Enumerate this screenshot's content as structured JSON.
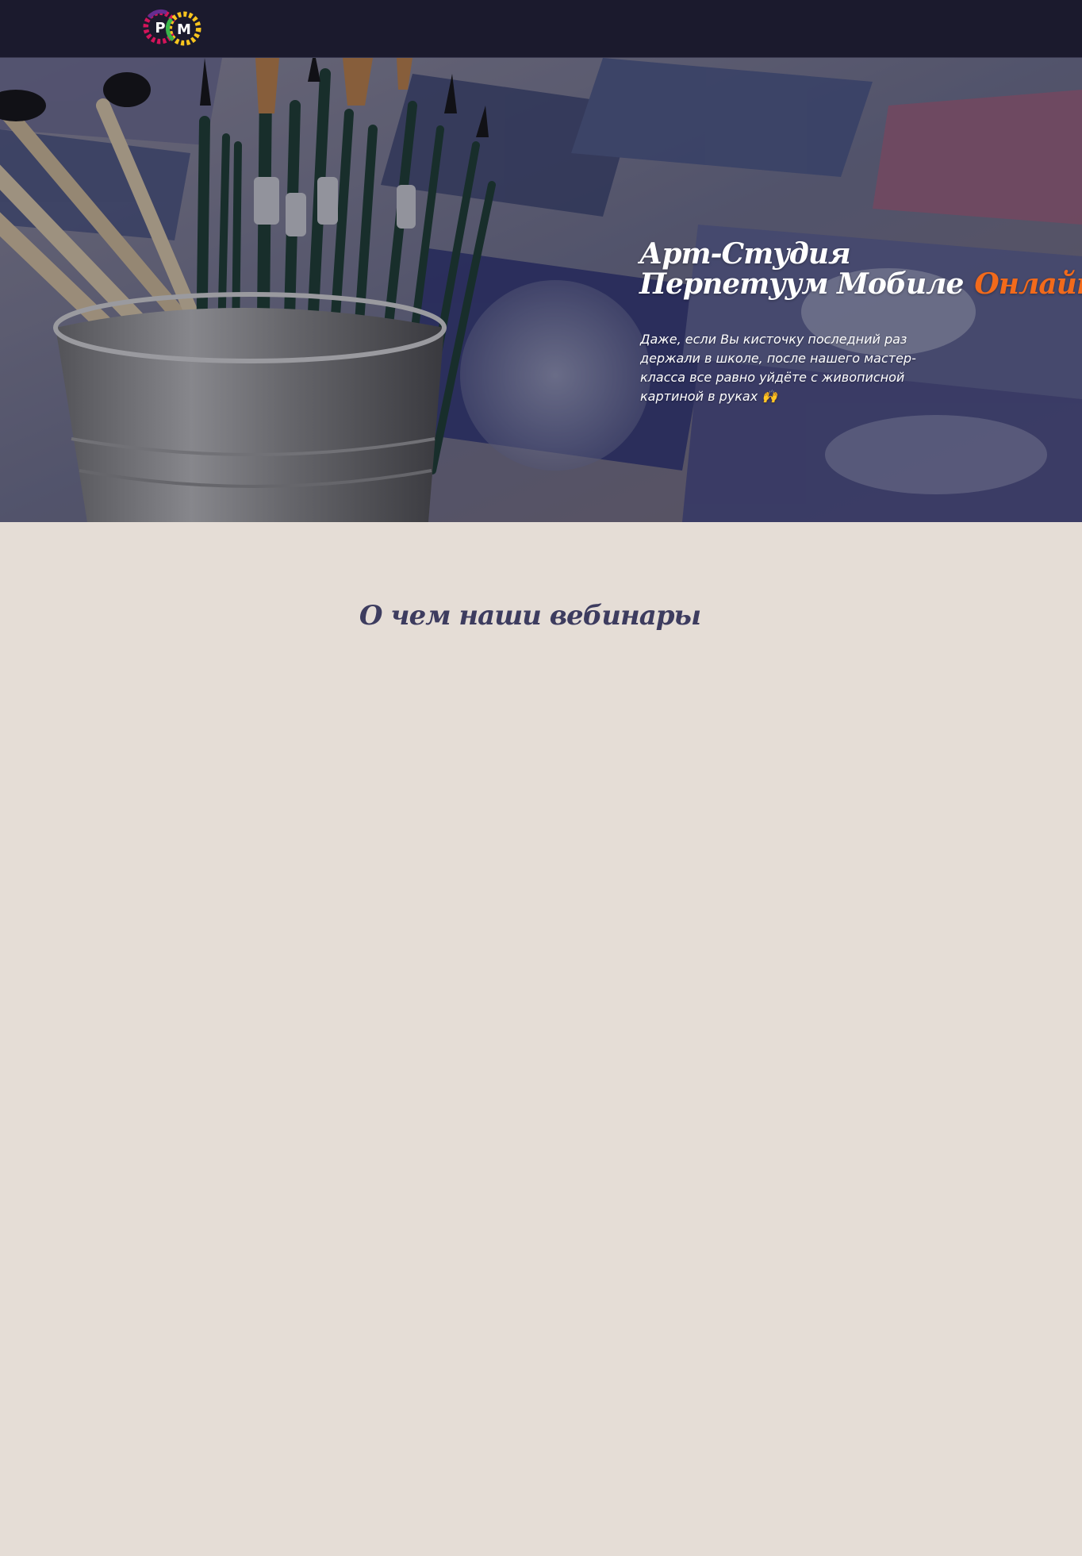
{
  "header": {
    "logo_letters": [
      "P",
      "M"
    ],
    "logo_colors": [
      "#d4145a",
      "#f7931e"
    ]
  },
  "hero": {
    "title_line1": "Арт-Студия",
    "title_line2": "Перпетуум Мобиле",
    "title_accent": "Онлайн",
    "accent_color": "#f26a1b",
    "text": "Даже, если Вы кисточку последний раз держали в школе, после нашего мастер-класса все равно уйдёте с живописной картиной в руках 🙌",
    "image": "paint-brushes-in-metal-cup-photo"
  },
  "webinars": {
    "title": "О чем наши вебинары"
  },
  "colors": {
    "header_bg": "#1b1a2d",
    "page_bg": "#e5ddd6",
    "section_title": "#3d3c5f"
  }
}
